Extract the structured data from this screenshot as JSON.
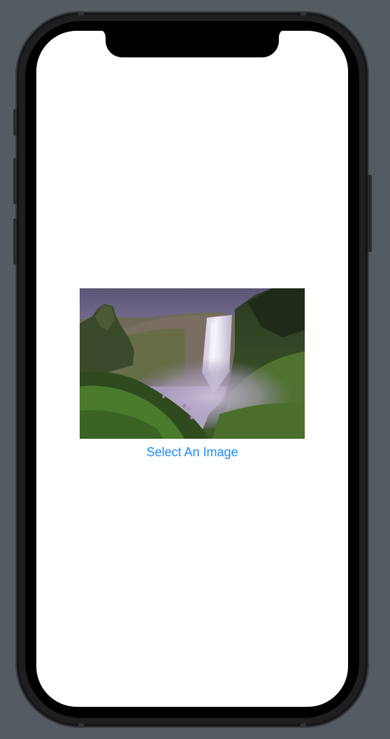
{
  "screen": {
    "select_button_label": "Select An Image",
    "accent_color": "#1a8cff"
  },
  "image": {
    "subject": "waterfall-landscape-photo"
  },
  "device": {
    "frame_color": "#1f1f21",
    "background_color": "#545b63"
  }
}
